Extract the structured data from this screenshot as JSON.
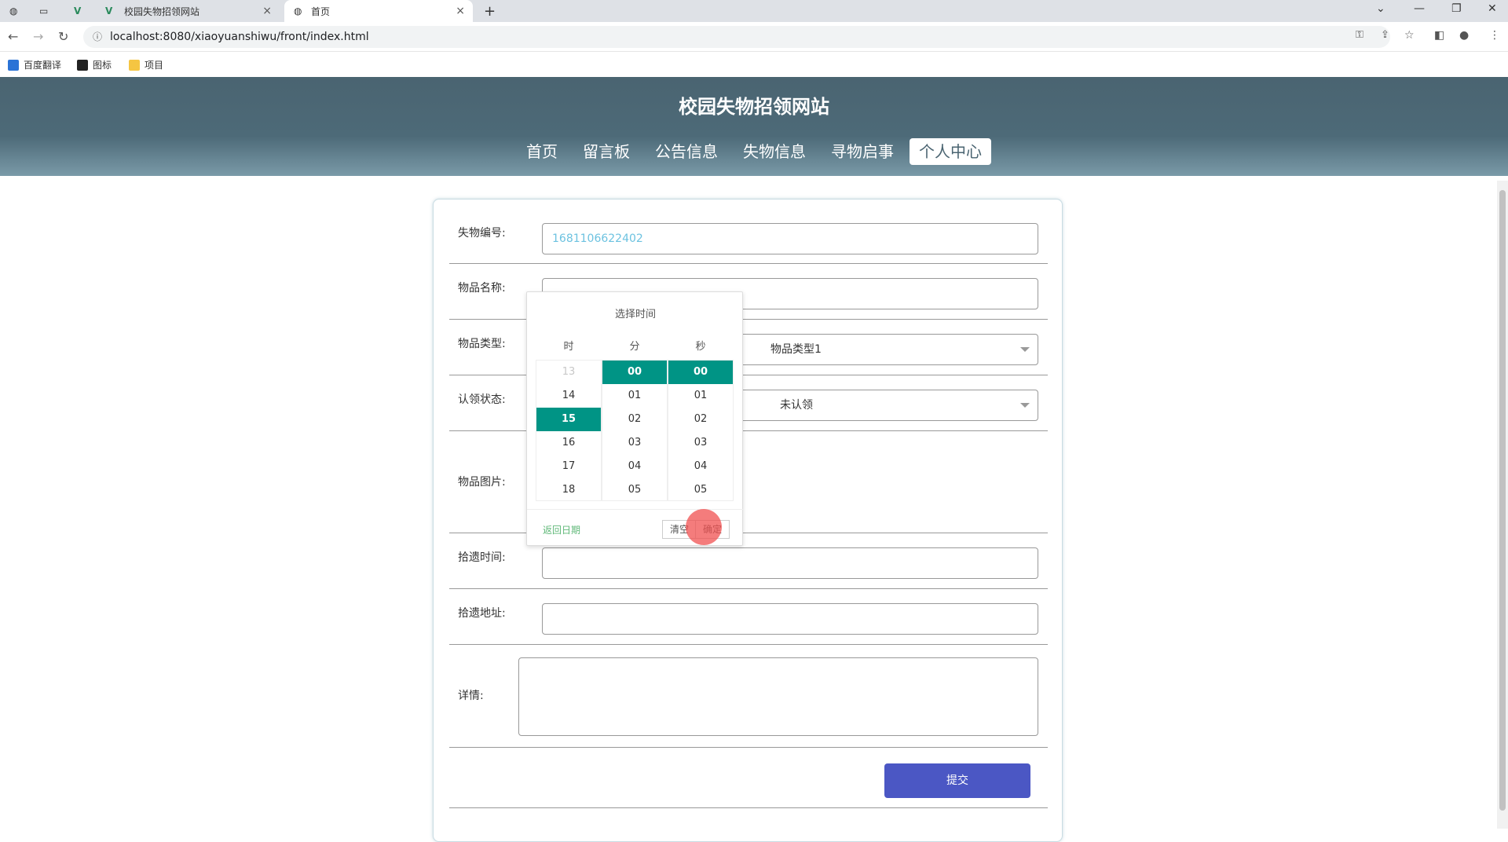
{
  "browser": {
    "tabs": [
      {
        "title": "校园失物招领网站"
      },
      {
        "title": "首页"
      }
    ],
    "url": "localhost:8080/xiaoyuanshiwu/front/index.html",
    "bookmarks": [
      "百度翻译",
      "图标",
      "项目"
    ]
  },
  "site": {
    "title": "校园失物招领网站",
    "nav": [
      "首页",
      "留言板",
      "公告信息",
      "失物信息",
      "寻物启事",
      "个人中心"
    ]
  },
  "form": {
    "id_label": "失物编号:",
    "id_value": "1681106622402",
    "name_label": "物品名称:",
    "type_label": "物品类型:",
    "type_value": "物品类型1",
    "status_label": "认领状态:",
    "status_value": "未认领",
    "image_label": "物品图片:",
    "time_label": "拾遗时间:",
    "address_label": "拾遗地址:",
    "detail_label": "详情:",
    "submit_label": "提交"
  },
  "picker": {
    "title": "选择时间",
    "col_hour": "时",
    "col_minute": "分",
    "col_second": "秒",
    "hours": [
      "13",
      "14",
      "15",
      "16",
      "17",
      "18"
    ],
    "minutes": [
      "00",
      "01",
      "02",
      "03",
      "04",
      "05"
    ],
    "seconds": [
      "00",
      "01",
      "02",
      "03",
      "04",
      "05"
    ],
    "back_label": "返回日期",
    "clear_label": "清空",
    "confirm_label": "确定"
  },
  "colors": {
    "accent": "#009485",
    "submit": "#4b57c4",
    "header": "#4a6471"
  }
}
